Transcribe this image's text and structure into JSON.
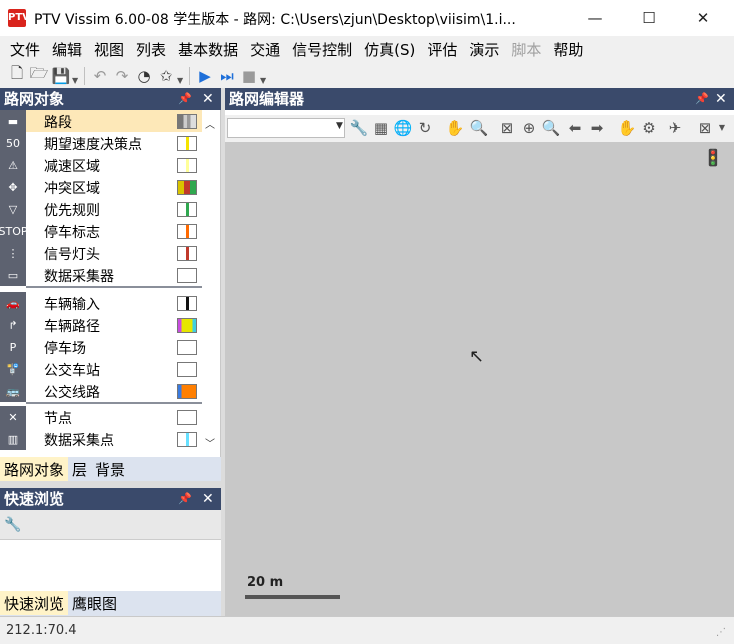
{
  "window": {
    "icon_text": "PTV",
    "title": "PTV Vissim 6.00-08 学生版本 - 路网: C:\\Users\\zjun\\Desktop\\viisim\\1.i...",
    "min_glyph": "—",
    "max_glyph": "☐",
    "close_glyph": "✕"
  },
  "menu": [
    {
      "label": "文件",
      "disabled": false
    },
    {
      "label": "编辑",
      "disabled": false
    },
    {
      "label": "视图",
      "disabled": false
    },
    {
      "label": "列表",
      "disabled": false
    },
    {
      "label": "基本数据",
      "disabled": false
    },
    {
      "label": "交通",
      "disabled": false
    },
    {
      "label": "信号控制",
      "disabled": false
    },
    {
      "label": "仿真(S)",
      "disabled": false
    },
    {
      "label": "评估",
      "disabled": false
    },
    {
      "label": "演示",
      "disabled": false
    },
    {
      "label": "脚本",
      "disabled": true
    },
    {
      "label": "帮助",
      "disabled": false
    }
  ],
  "toolbar": {
    "icons": {
      "new": "🗋",
      "open": "🗁",
      "save": "💾",
      "undo": "↶",
      "redo": "↷",
      "gauge": "◔",
      "star": "✩",
      "run": "▶",
      "step": "⏭",
      "stop": "■",
      "drop": "▼"
    }
  },
  "panels": {
    "network_objects": {
      "title": "路网对象",
      "pin": "📌",
      "close": "✕",
      "scroll_up": "︿",
      "scroll_down": "﹀",
      "items": [
        {
          "label": "路段",
          "icon": "▬",
          "selected": true,
          "swatch": "#a0a0a0"
        },
        {
          "label": "期望速度决策点",
          "icon": "50",
          "selected": false,
          "swatch": "#f5e400"
        },
        {
          "label": "减速区域",
          "icon": "⚠",
          "selected": false,
          "swatch": "#ffff99"
        },
        {
          "label": "冲突区域",
          "icon": "✥",
          "selected": false,
          "swatch": "#d9c300"
        },
        {
          "label": "优先规则",
          "icon": "▽",
          "selected": false,
          "swatch": "#2fa84f"
        },
        {
          "label": "停车标志",
          "icon": "STOP",
          "selected": false,
          "swatch": "#ff6a00"
        },
        {
          "label": "信号灯头",
          "icon": "⋮",
          "selected": false,
          "swatch": "#c0392b"
        },
        {
          "label": "数据采集器",
          "icon": "▭",
          "selected": false,
          "swatch": "#ffffff"
        },
        {
          "label": "车辆输入",
          "icon": "🚗",
          "selected": false,
          "swatch": "#111111"
        },
        {
          "label": "车辆路径",
          "icon": "↱",
          "selected": false,
          "swatch": "#e6e600"
        },
        {
          "label": "停车场",
          "icon": "P",
          "selected": false,
          "swatch": "#ffffff"
        },
        {
          "label": "公交车站",
          "icon": "🚏",
          "selected": false,
          "swatch": "#ffffff"
        },
        {
          "label": "公交线路",
          "icon": "🚌",
          "selected": false,
          "swatch": "#ff7f00"
        },
        {
          "label": "节点",
          "icon": "✕",
          "selected": false,
          "swatch": "#ffffff"
        },
        {
          "label": "数据采集点",
          "icon": "▥",
          "selected": false,
          "swatch": "#66e0ff"
        }
      ],
      "tabs": [
        {
          "label": "路网对象",
          "active": true
        },
        {
          "label": "层",
          "active": false
        },
        {
          "label": "背景",
          "active": false
        }
      ]
    },
    "quick_view": {
      "title": "快速浏览",
      "pin": "📌",
      "close": "✕",
      "wrench": "🔧",
      "tabs": [
        {
          "label": "快速浏览",
          "active": true
        },
        {
          "label": "鹰眼图",
          "active": false
        }
      ]
    },
    "network_editor": {
      "title": "路网编辑器",
      "pin": "📌",
      "close": "✕",
      "combo_arrow": "▼",
      "tool_icons": [
        "🔧",
        "▦",
        "🌐",
        "↻",
        "✋",
        "🔍",
        "⊠",
        "⊕",
        "🔍",
        "⬅",
        "➡",
        "✋",
        "⚙",
        "✈",
        "⊠",
        "▼"
      ],
      "signal_icon": "🚦",
      "cursor_icon": "↖",
      "scale_label": "20 m"
    }
  },
  "status": {
    "coords": "212.1:70.4",
    "grip": "⋰"
  },
  "colors": {
    "panel_header": "#3a4a6b",
    "selected_row": "#fde8b8",
    "canvas": "#c8c8c8",
    "active_tab": "#fff3c8"
  }
}
